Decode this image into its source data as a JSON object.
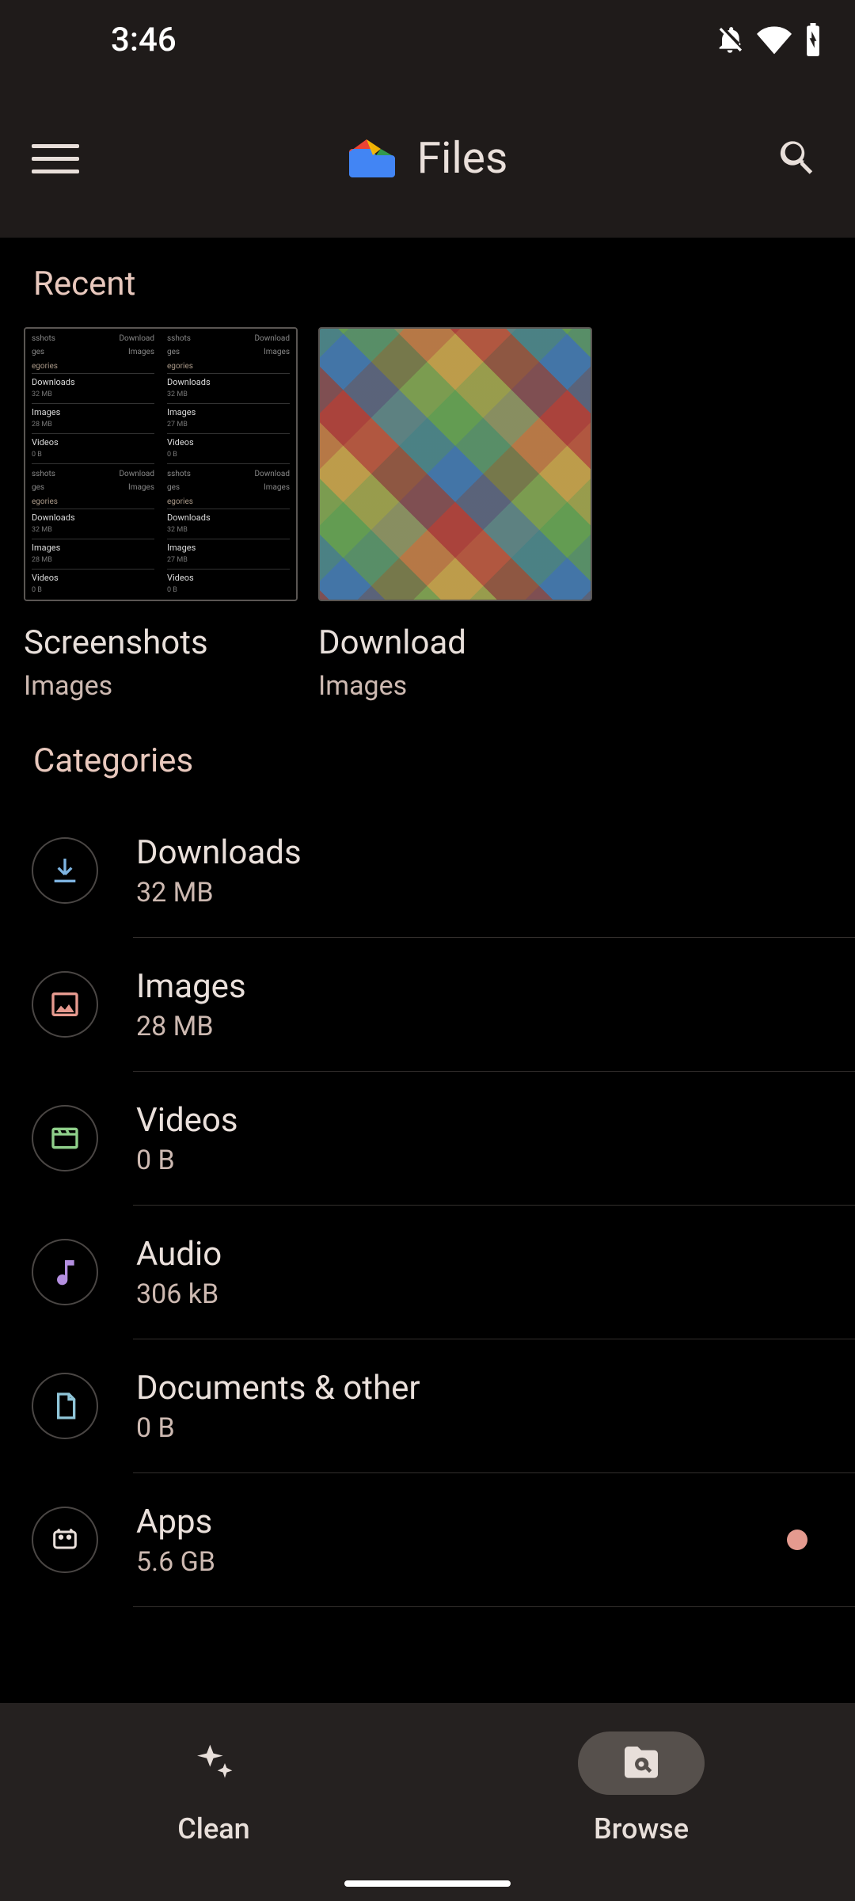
{
  "status": {
    "time": "3:46"
  },
  "appbar": {
    "title": "Files"
  },
  "recent": {
    "header": "Recent",
    "cards": [
      {
        "title": "Screenshots",
        "subtitle": "Images"
      },
      {
        "title": "Download",
        "subtitle": "Images"
      }
    ]
  },
  "categories": {
    "header": "Categories",
    "items": [
      {
        "name": "Downloads",
        "size": "32 MB",
        "icon": "download",
        "color": "#7db3e0",
        "dot": false
      },
      {
        "name": "Images",
        "size": "28 MB",
        "icon": "image",
        "color": "#e69a8f",
        "dot": false
      },
      {
        "name": "Videos",
        "size": "0 B",
        "icon": "video",
        "color": "#8fcf8a",
        "dot": false
      },
      {
        "name": "Audio",
        "size": "306 kB",
        "icon": "audio",
        "color": "#b48fe0",
        "dot": false
      },
      {
        "name": "Documents & other",
        "size": "0 B",
        "icon": "document",
        "color": "#8fc5d8",
        "dot": false
      },
      {
        "name": "Apps",
        "size": "5.6 GB",
        "icon": "apps",
        "color": "#eae0db",
        "dot": true
      }
    ]
  },
  "bottomnav": {
    "items": [
      {
        "label": "Clean",
        "active": false
      },
      {
        "label": "Browse",
        "active": true
      }
    ]
  }
}
